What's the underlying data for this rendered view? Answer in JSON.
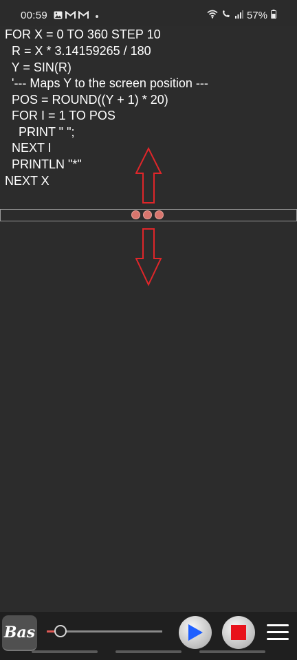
{
  "status": {
    "time": "00:59",
    "battery": "57%"
  },
  "editor": {
    "lines": [
      "FOR X = 0 TO 360 STEP 10",
      "  R = X * 3.14159265 / 180",
      "  Y = SIN(R)",
      "  '--- Maps Y to the screen position ---",
      "  POS = ROUND((Y + 1) * 20)",
      "  FOR I = 1 TO POS",
      "    PRINT \" \";",
      "  NEXT I",
      "  PRINTLN \"*\"",
      "NEXT X"
    ]
  },
  "toolbar": {
    "logo_text": "Bas",
    "slider_value": 0.05
  },
  "colors": {
    "background": "#2c2c2c",
    "grip": "#d8756d",
    "arrow": "#e0262a",
    "play": "#1f5fff",
    "stop": "#e8121b"
  }
}
